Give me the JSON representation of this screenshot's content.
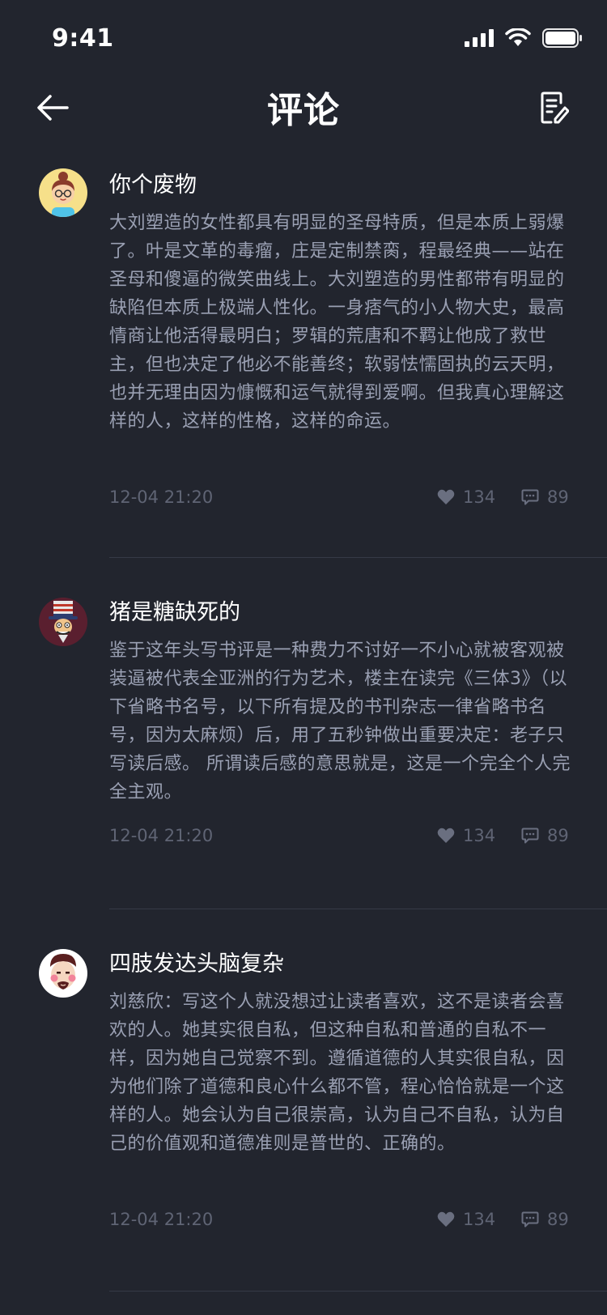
{
  "status_bar": {
    "time": "9:41"
  },
  "nav": {
    "title": "评论"
  },
  "comments": [
    {
      "username": "你个废物",
      "content": "大刘塑造的女性都具有明显的圣母特质，但是本质上弱爆了。叶是文革的毒瘤，庄是定制禁脔，程最经典——站在圣母和傻逼的微笑曲线上。大刘塑造的男性都带有明显的缺陷但本质上极端人性化。一身痞气的小人物大史，最高情商让他活得最明白；罗辑的荒唐和不羁让他成了救世主，但也决定了他必不能善终；软弱怯懦固执的云天明，也并无理由因为慷慨和运气就得到爱啊。但我真心理解这样的人，这样的性格，这样的命运。",
      "time": "12-04 21:20",
      "likes": "134",
      "replies": "89"
    },
    {
      "username": "猪是糖缺死的",
      "content": "鉴于这年头写书评是一种费力不讨好一不小心就被客观被装逼被代表全亚洲的行为艺术，楼主在读完《三体3》（以下省略书名号，以下所有提及的书刊杂志一律省略书名号，因为太麻烦）后，用了五秒钟做出重要决定：老子只写读后感。 所谓读后感的意思就是，这是一个完全个人完全主观。",
      "time": "12-04 21:20",
      "likes": "134",
      "replies": "89"
    },
    {
      "username": "四肢发达头脑复杂",
      "content": "刘慈欣：写这个人就没想过让读者喜欢，这不是读者会喜欢的人。她其实很自私，但这种自私和普通的自私不一样，因为她自己觉察不到。遵循道德的人其实很自私，因为他们除了道德和良心什么都不管，程心恰恰就是一个这样的人。她会认为自己很崇高，认为自己不自私，认为自己的价值观和道德准则是普世的、正确的。",
      "time": "12-04 21:20",
      "likes": "134",
      "replies": "89"
    }
  ],
  "colors": {
    "background": "#22252e",
    "text_primary": "#ffffff",
    "text_body": "#9aa0b3",
    "text_meta": "#5f6474",
    "divider": "#363a46"
  },
  "icons": {
    "back": "arrow-left-icon",
    "compose": "edit-note-icon",
    "like": "heart-icon",
    "reply": "comment-bubble-icon"
  }
}
